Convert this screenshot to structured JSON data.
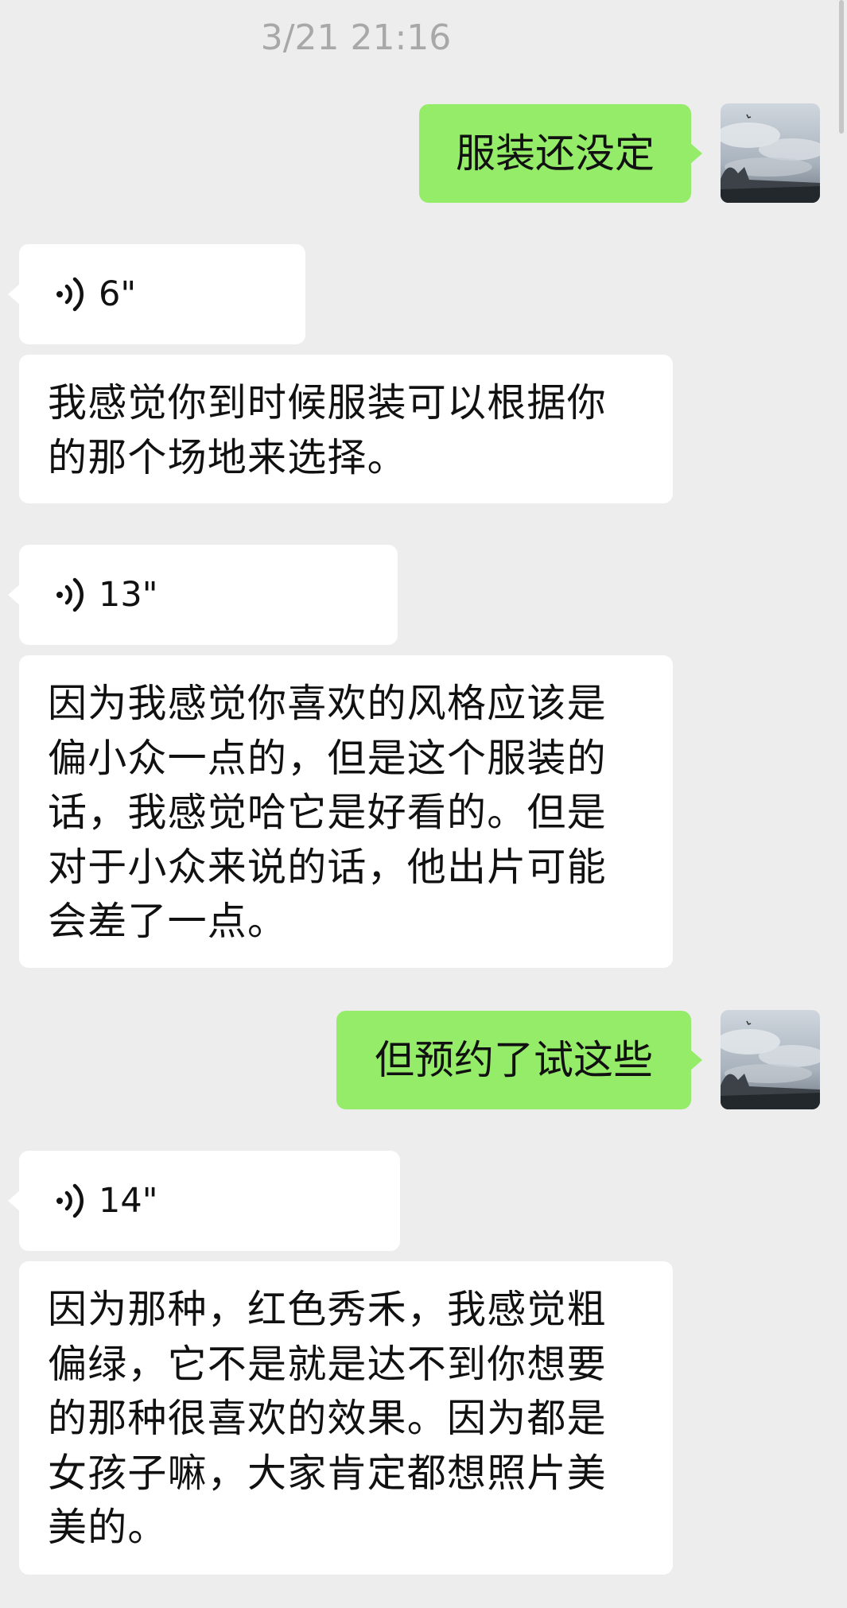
{
  "chat": {
    "timestamp": "3/21 21:16",
    "messages": [
      {
        "side": "sent",
        "type": "text",
        "text": "服装还没定"
      },
      {
        "side": "received",
        "type": "voice",
        "duration": "6\""
      },
      {
        "side": "received",
        "type": "text",
        "text": "我感觉你到时候服装可以根据你的那个场地来选择。"
      },
      {
        "side": "received",
        "type": "voice",
        "duration": "13\""
      },
      {
        "side": "received",
        "type": "text",
        "text": "因为我感觉你喜欢的风格应该是偏小众一点的，但是这个服装的话，我感觉哈它是好看的。但是对于小众来说的话，他出片可能会差了一点。"
      },
      {
        "side": "sent",
        "type": "text",
        "text": "但预约了试这些"
      },
      {
        "side": "received",
        "type": "voice",
        "duration": "14\""
      },
      {
        "side": "received",
        "type": "text",
        "text": "因为那种，红色秀禾，我感觉粗偏绿，它不是就是达不到你想要的那种很喜欢的效果。因为都是女孩子嘛，大家肯定都想照片美美的。"
      }
    ]
  },
  "colors": {
    "background": "#ededed",
    "sent_bubble": "#95ec69",
    "received_bubble": "#ffffff",
    "timestamp": "#a8a8a8"
  },
  "icons": {
    "voice": "voice-wave-icon",
    "avatar": "cloudy-sky-avatar"
  }
}
